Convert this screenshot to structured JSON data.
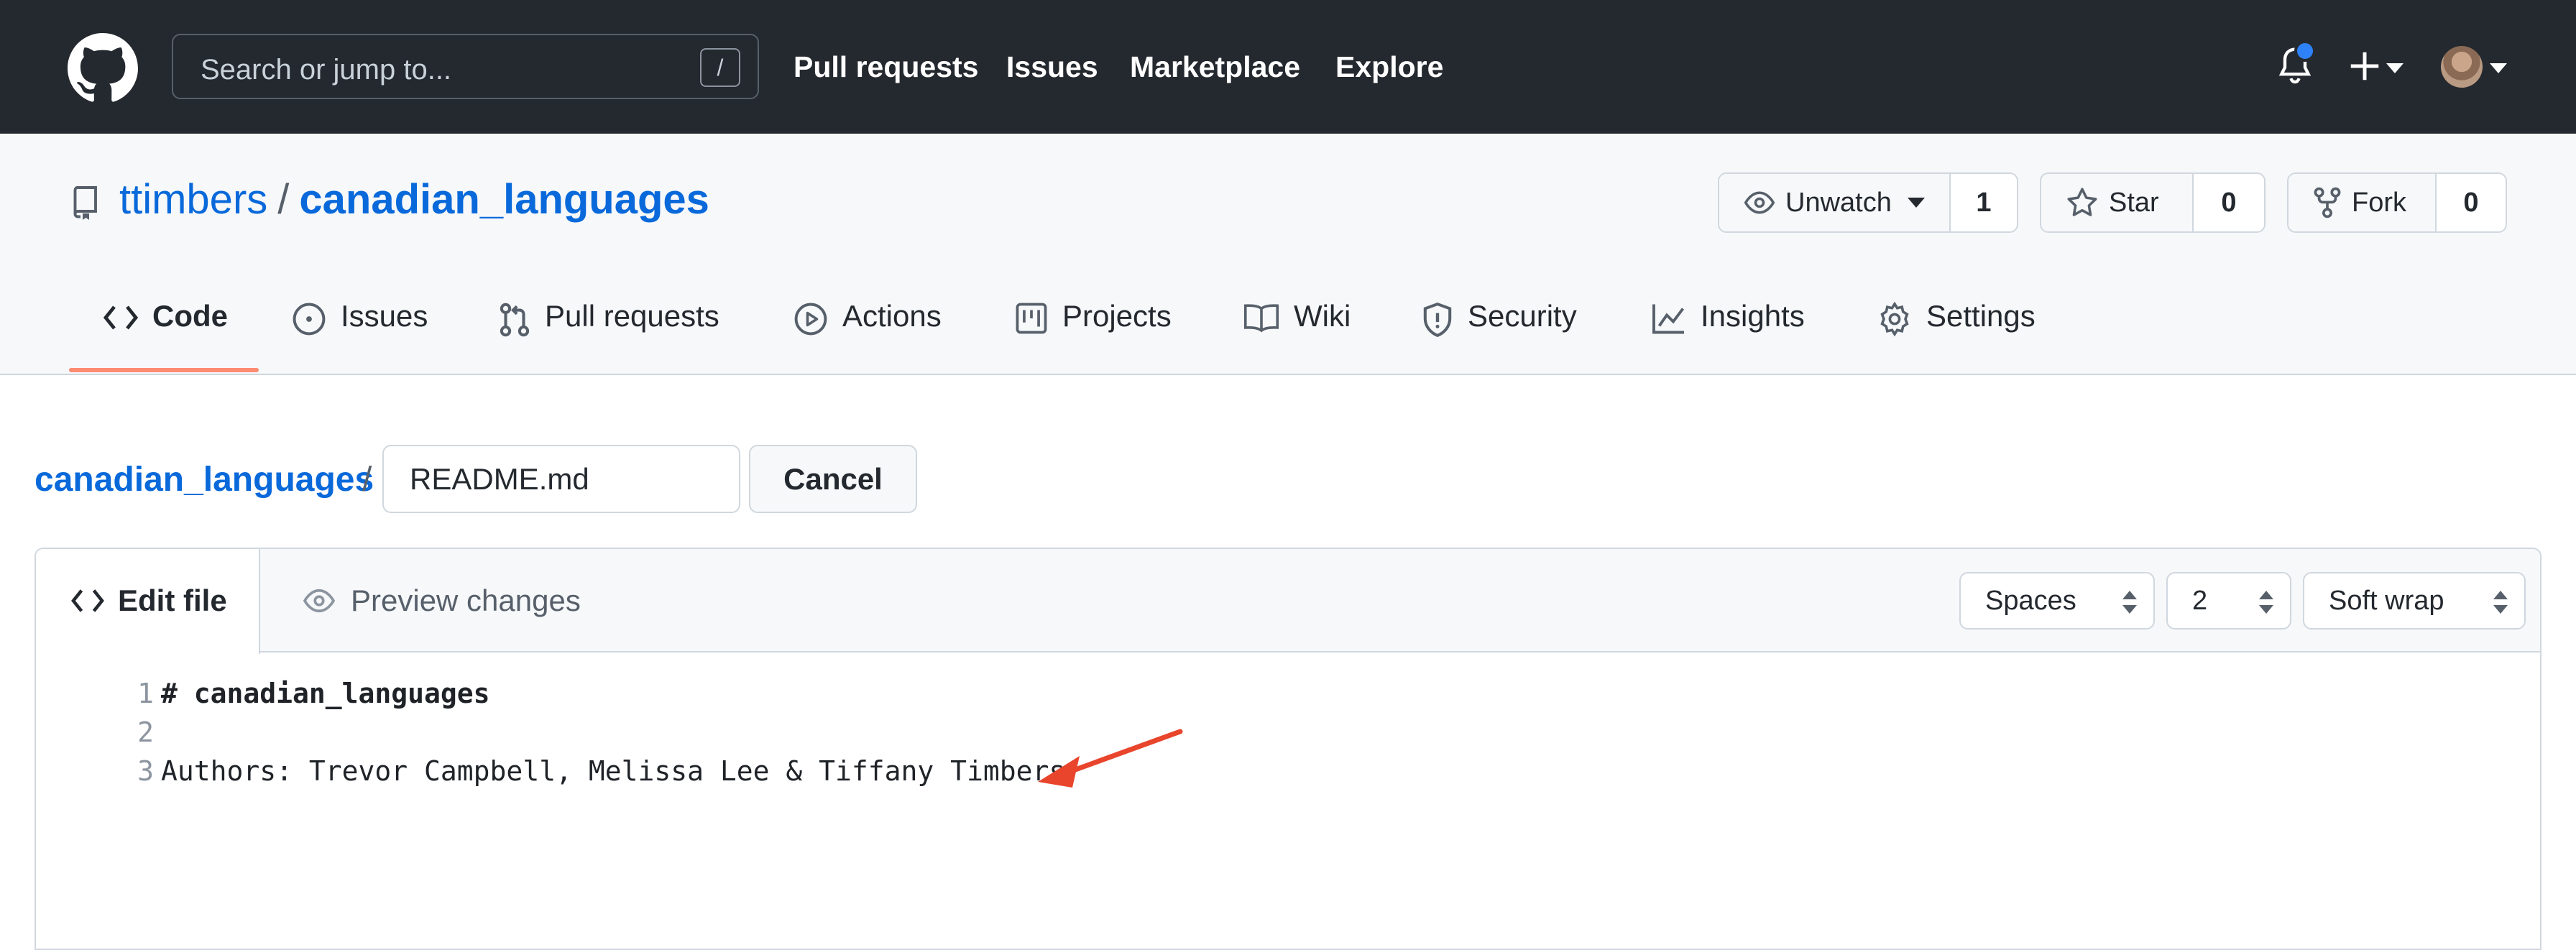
{
  "header": {
    "search_placeholder": "Search or jump to...",
    "search_shortcut": "/",
    "nav": [
      "Pull requests",
      "Issues",
      "Marketplace",
      "Explore"
    ],
    "icons": [
      "github-logo",
      "bell-icon",
      "plus-icon",
      "avatar"
    ],
    "notification_dot_color": "#2f81f7"
  },
  "repo": {
    "owner": "ttimbers",
    "separator": "/",
    "name": "canadian_languages",
    "watch": {
      "label": "Unwatch",
      "count": "1"
    },
    "star": {
      "label": "Star",
      "count": "0"
    },
    "fork": {
      "label": "Fork",
      "count": "0"
    }
  },
  "tabs": [
    {
      "label": "Code",
      "icon": "code-icon",
      "active": true
    },
    {
      "label": "Issues",
      "icon": "issue-icon"
    },
    {
      "label": "Pull requests",
      "icon": "pull-request-icon"
    },
    {
      "label": "Actions",
      "icon": "play-icon"
    },
    {
      "label": "Projects",
      "icon": "project-icon"
    },
    {
      "label": "Wiki",
      "icon": "book-icon"
    },
    {
      "label": "Security",
      "icon": "shield-icon"
    },
    {
      "label": "Insights",
      "icon": "graph-icon"
    },
    {
      "label": "Settings",
      "icon": "gear-icon"
    }
  ],
  "edit": {
    "breadcrumb_repo": "canadian_languages",
    "breadcrumb_sep": "/",
    "filename": "README.md",
    "cancel_label": "Cancel"
  },
  "editor": {
    "tab_edit": "Edit file",
    "tab_preview": "Preview changes",
    "indent_mode": "Spaces",
    "indent_size": "2",
    "wrap_mode": "Soft wrap",
    "lines": [
      {
        "number": "1",
        "text": "# canadian_languages"
      },
      {
        "number": "2",
        "text": ""
      },
      {
        "number": "3",
        "text": "Authors: Trevor Campbell, Melissa Lee & Tiffany Timbers"
      }
    ]
  },
  "colors": {
    "topbar_bg": "#24292f",
    "link_blue": "#0969da",
    "tab_underline": "#fd8c73",
    "annotation_arrow": "#e8452c"
  }
}
